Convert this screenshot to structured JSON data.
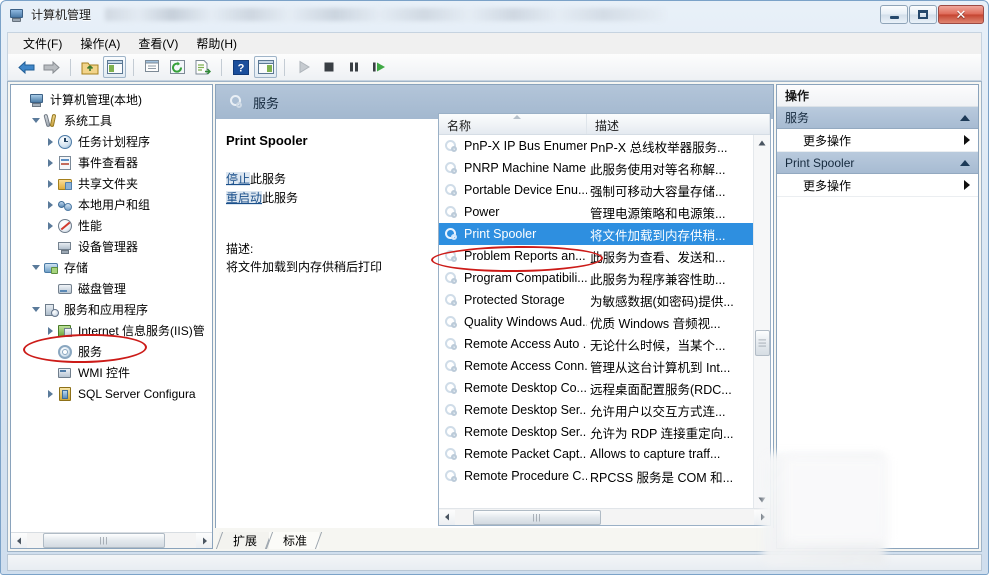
{
  "window": {
    "title": "计算机管理",
    "title_icon": "computer-management-icon",
    "minimize_label": "最小化",
    "maximize_label": "最大化",
    "close_label": "关闭",
    "close_glyph": "✕"
  },
  "menubar": {
    "items": [
      {
        "text": "文件(F)",
        "mnemonic": "F"
      },
      {
        "text": "操作(A)",
        "mnemonic": "A"
      },
      {
        "text": "查看(V)",
        "mnemonic": "V"
      },
      {
        "text": "帮助(H)",
        "mnemonic": "H"
      }
    ]
  },
  "toolbar": {
    "buttons": [
      {
        "name": "back-icon"
      },
      {
        "name": "forward-icon"
      },
      {
        "name": "up-folder-icon"
      },
      {
        "name": "show-hide-tree-icon"
      },
      {
        "name": "properties-icon"
      },
      {
        "name": "refresh-icon"
      },
      {
        "name": "export-list-icon"
      },
      {
        "name": "help-icon"
      },
      {
        "name": "show-action-pane-icon"
      },
      {
        "name": "start-service-icon"
      },
      {
        "name": "stop-service-icon"
      },
      {
        "name": "pause-service-icon"
      },
      {
        "name": "restart-service-icon"
      }
    ]
  },
  "tree": {
    "items": [
      {
        "label": "计算机管理(本地)",
        "indent": 0,
        "expander": "none",
        "icon": "computer-icon"
      },
      {
        "label": "系统工具",
        "indent": 1,
        "expander": "expanded",
        "icon": "system-tools-icon"
      },
      {
        "label": "任务计划程序",
        "indent": 2,
        "expander": "collapsed",
        "icon": "task-scheduler-icon"
      },
      {
        "label": "事件查看器",
        "indent": 2,
        "expander": "collapsed",
        "icon": "event-viewer-icon"
      },
      {
        "label": "共享文件夹",
        "indent": 2,
        "expander": "collapsed",
        "icon": "shared-folders-icon"
      },
      {
        "label": "本地用户和组",
        "indent": 2,
        "expander": "collapsed",
        "icon": "local-users-groups-icon"
      },
      {
        "label": "性能",
        "indent": 2,
        "expander": "collapsed",
        "icon": "performance-icon"
      },
      {
        "label": "设备管理器",
        "indent": 2,
        "expander": "none",
        "icon": "device-manager-icon"
      },
      {
        "label": "存储",
        "indent": 1,
        "expander": "expanded",
        "icon": "storage-icon"
      },
      {
        "label": "磁盘管理",
        "indent": 2,
        "expander": "none",
        "icon": "disk-management-icon"
      },
      {
        "label": "服务和应用程序",
        "indent": 1,
        "expander": "expanded",
        "icon": "services-apps-icon"
      },
      {
        "label": "Internet 信息服务(IIS)管",
        "indent": 2,
        "expander": "collapsed",
        "icon": "iis-manager-icon"
      },
      {
        "label": "服务",
        "indent": 2,
        "expander": "none",
        "icon": "services-icon",
        "highlighted": true
      },
      {
        "label": "WMI 控件",
        "indent": 2,
        "expander": "none",
        "icon": "wmi-control-icon"
      },
      {
        "label": "SQL Server Configura",
        "indent": 2,
        "expander": "collapsed",
        "icon": "sql-server-config-icon"
      }
    ]
  },
  "middle": {
    "banner_title": "服务",
    "banner_icon": "services-icon",
    "detail": {
      "service_name": "Print Spooler",
      "links": [
        {
          "link_text": "停止",
          "rest_text": "此服务"
        },
        {
          "link_text": "重启动",
          "rest_text": "此服务"
        }
      ],
      "description_label": "描述:",
      "description_text": "将文件加载到内存供稍后打印"
    },
    "list": {
      "columns": [
        {
          "label": "名称",
          "width": 148,
          "sorted": "asc"
        },
        {
          "label": "描述",
          "width": 175,
          "sorted": "none"
        }
      ],
      "rows": [
        {
          "name": "PnP-X IP Bus Enumer...",
          "desc": "PnP-X 总线枚举器服务..."
        },
        {
          "name": "PNRP Machine Name...",
          "desc": "此服务使用对等名称解..."
        },
        {
          "name": "Portable Device Enu...",
          "desc": "强制可移动大容量存储..."
        },
        {
          "name": "Power",
          "desc": "管理电源策略和电源策..."
        },
        {
          "name": "Print Spooler",
          "desc": "将文件加载到内存供稍...",
          "selected": true
        },
        {
          "name": "Problem Reports an...",
          "desc": "此服务为查看、发送和..."
        },
        {
          "name": "Program Compatibili...",
          "desc": "此服务为程序兼容性助..."
        },
        {
          "name": "Protected Storage",
          "desc": "为敏感数据(如密码)提供..."
        },
        {
          "name": "Quality Windows Aud...",
          "desc": "优质 Windows 音频视..."
        },
        {
          "name": "Remote Access Auto ...",
          "desc": "无论什么时候，当某个..."
        },
        {
          "name": "Remote Access Conn...",
          "desc": "管理从这台计算机到 Int..."
        },
        {
          "name": "Remote Desktop Co...",
          "desc": "远程桌面配置服务(RDC..."
        },
        {
          "name": "Remote Desktop Ser...",
          "desc": "允许用户以交互方式连..."
        },
        {
          "name": "Remote Desktop Ser...",
          "desc": "允许为 RDP 连接重定向..."
        },
        {
          "name": "Remote Packet Capt...",
          "desc": "Allows to capture traff..."
        },
        {
          "name": "Remote Procedure C...",
          "desc": "RPCSS 服务是 COM 和..."
        }
      ]
    },
    "tabs": [
      {
        "label": "扩展",
        "active": false
      },
      {
        "label": "标准",
        "active": true
      }
    ]
  },
  "actions": {
    "title": "操作",
    "groups": [
      {
        "header": "服务",
        "items": [
          {
            "label": "更多操作",
            "submenu": true
          }
        ]
      },
      {
        "header": "Print Spooler",
        "items": [
          {
            "label": "更多操作",
            "submenu": true
          }
        ]
      }
    ]
  },
  "annotations": [
    {
      "name": "tree-services-highlight",
      "shape": "ellipse",
      "color": "#cc1b18"
    },
    {
      "name": "list-print-spooler-highlight",
      "shape": "ellipse",
      "color": "#cc1b18"
    }
  ],
  "colors": {
    "selection_blue": "#2e8fe0",
    "banner_blue": "#a8bdd4",
    "group_header_blue": "#b0c3d8",
    "annotation_red": "#cc1b18",
    "link_blue": "#1a4f8a"
  }
}
